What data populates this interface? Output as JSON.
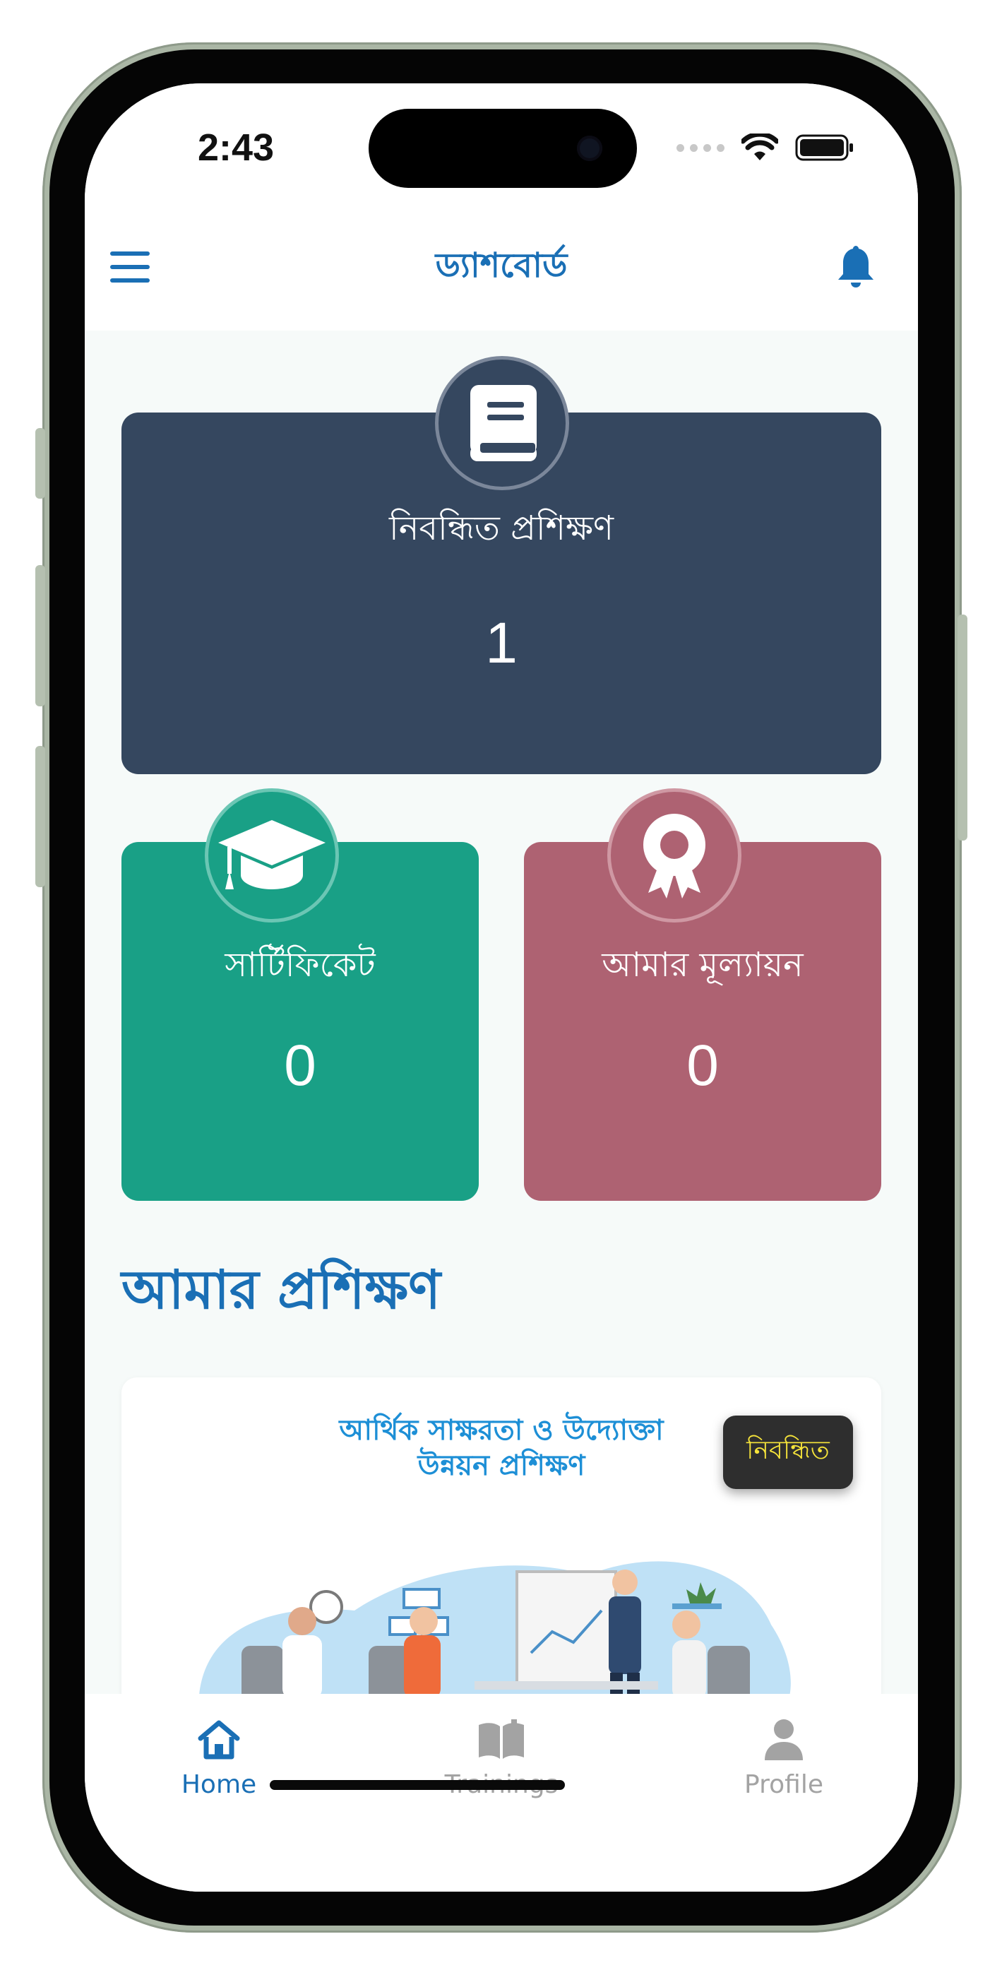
{
  "status_bar": {
    "time": "2:43"
  },
  "header": {
    "title": "ড্যাশবোর্ড"
  },
  "cards": {
    "registered_trainings": {
      "label": "নিবন্ধিত প্রশিক্ষণ",
      "value": "1"
    },
    "certificates": {
      "label": "সার্টিফিকেট",
      "value": "0"
    },
    "my_assessment": {
      "label": "আমার মূল্যায়ন",
      "value": "0"
    }
  },
  "section": {
    "title": "আমার প্রশিক্ষণ"
  },
  "training": {
    "title_line1": "আর্থিক সাক্ষরতা ও উদ্যোক্তা",
    "title_line2": "উন্নয়ন প্রশিক্ষণ",
    "status": "নিবন্ধিত"
  },
  "bottom_nav": {
    "items": [
      {
        "label": "Home",
        "icon": "home-icon",
        "active": true
      },
      {
        "label": "Trainings",
        "icon": "book-open-icon",
        "active": false
      },
      {
        "label": "Profile",
        "icon": "person-icon",
        "active": false
      }
    ]
  },
  "colors": {
    "accent": "#1a6fb5",
    "card_main": "#35475f",
    "card_green": "#19a086",
    "card_rose": "#ae6272",
    "chip_text": "#f6e43a",
    "nav_inactive": "#9e9e9e"
  }
}
